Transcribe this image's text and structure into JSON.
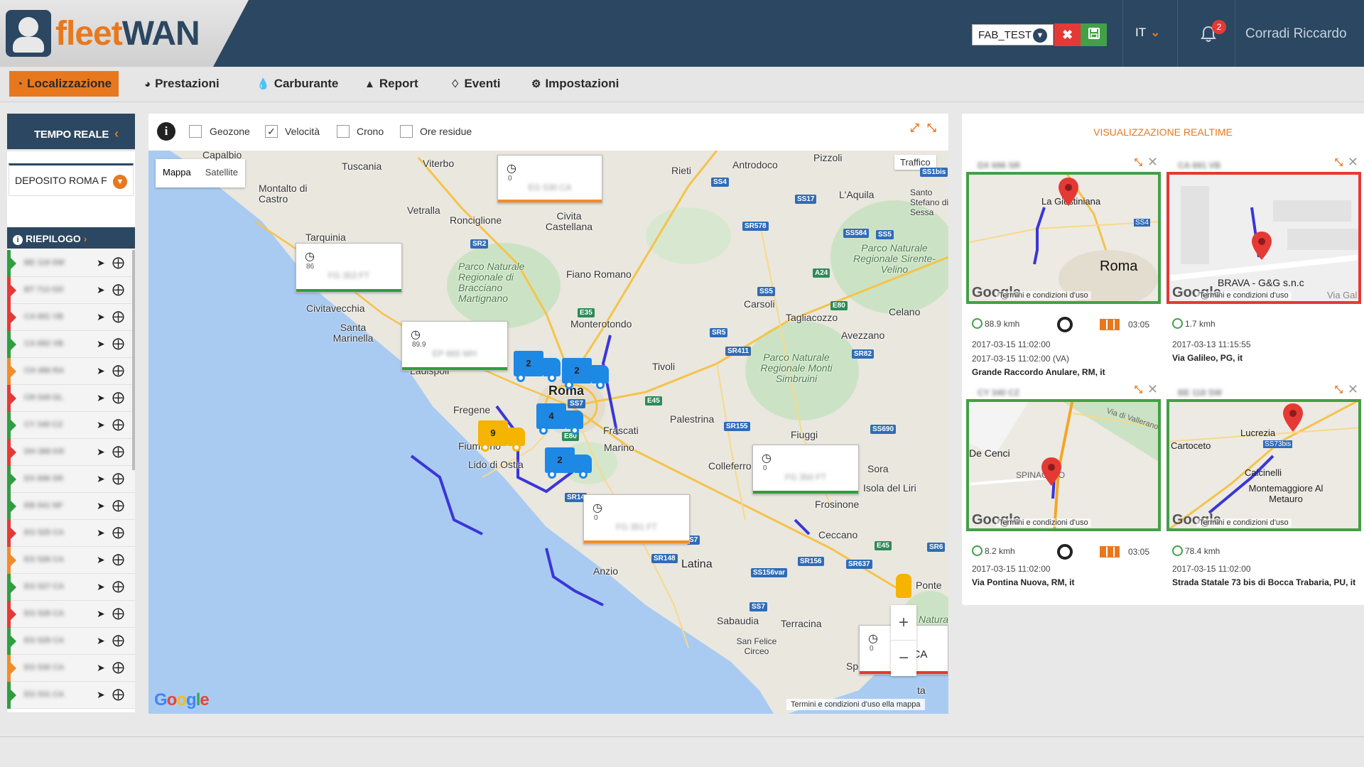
{
  "app": {
    "logo_part1": "fleet",
    "logo_part2": "WAN"
  },
  "header": {
    "profile_select": "FAB_TEST",
    "language": "IT",
    "notifications_count": "2",
    "user_name": "Corradi Riccardo"
  },
  "nav": {
    "items": [
      {
        "label": "Localizzazione",
        "icon": "dashboard-icon",
        "active": true
      },
      {
        "label": "Prestazioni",
        "icon": "pie-chart-icon"
      },
      {
        "label": "Carburante",
        "icon": "drop-icon"
      },
      {
        "label": "Report",
        "icon": "area-chart-icon"
      },
      {
        "label": "Eventi",
        "icon": "bell-icon"
      },
      {
        "label": "Impostazioni",
        "icon": "gear-icon"
      }
    ]
  },
  "left": {
    "mode_button": "TEMPO REALE",
    "depot_select": "DEPOSITO ROMA F",
    "summary_title": "RIEPILOGO",
    "vehicles": [
      {
        "plate": "BE 118 SW",
        "status_color": "#2e9e3f"
      },
      {
        "plate": "BT 713 GD",
        "status_color": "#e53935"
      },
      {
        "plate": "CA 691 VB",
        "status_color": "#e53935"
      },
      {
        "plate": "CA 692 VB",
        "status_color": "#2e9e3f"
      },
      {
        "plate": "CH 486 RA",
        "status_color": "#f28c28"
      },
      {
        "plate": "CR 549 DL",
        "status_color": "#e53935"
      },
      {
        "plate": "CY 340 CZ",
        "status_color": "#2e9e3f"
      },
      {
        "plate": "DH 388 KR",
        "status_color": "#e53935"
      },
      {
        "plate": "DX 696 SR",
        "status_color": "#2e9e3f"
      },
      {
        "plate": "EB 541 NF",
        "status_color": "#2e9e3f"
      },
      {
        "plate": "EG 525 CA",
        "status_color": "#e53935"
      },
      {
        "plate": "EG 526 CA",
        "status_color": "#f28c28"
      },
      {
        "plate": "EG 527 CA",
        "status_color": "#2e9e3f"
      },
      {
        "plate": "EG 528 CA",
        "status_color": "#e53935"
      },
      {
        "plate": "EG 529 CA",
        "status_color": "#2e9e3f"
      },
      {
        "plate": "EG 530 CA",
        "status_color": "#f28c28"
      },
      {
        "plate": "EG 531 CA",
        "status_color": "#2e9e3f"
      }
    ]
  },
  "map": {
    "filters": [
      {
        "label": "Geozone",
        "checked": false
      },
      {
        "label": "Velocità",
        "checked": true
      },
      {
        "label": "Crono",
        "checked": false
      },
      {
        "label": "Ore residue",
        "checked": false
      }
    ],
    "tab_map": "Mappa",
    "tab_satellite": "Satellite",
    "traffic_button": "Traffico",
    "terms": "Termini e condizioni d'uso",
    "terms_tail": "ella mappa",
    "google": "Google",
    "places": [
      "Capalbio",
      "Tuscania",
      "Viterbo",
      "Rieti",
      "Antrodoco",
      "Pizzoli",
      "L'Aquila",
      "Montalto di Castro",
      "Vetralla",
      "Ronciglione",
      "Civita Castellana",
      "Tarquinia",
      "Parco Naturale Regionale di Bracciano Martignano",
      "Fiano Romano",
      "Civitavecchia",
      "Santa Marinella",
      "Monterotondo",
      "Parco Naturale Regionale Sirente-Velino",
      "Carsoli",
      "Tagliacozzo",
      "Celano",
      "Avezzano",
      "Tivoli",
      "Roma",
      "Fregene",
      "Fiumicino",
      "Lido di Ostia",
      "Frascati",
      "Marino",
      "Palestrina",
      "Parco Naturale Regionale Monti Simbruini",
      "Fiuggi",
      "Colleferro",
      "Sora",
      "Isola del Liri",
      "Frosinone",
      "Ceccano",
      "Latina",
      "Anzio",
      "Sabaudia",
      "Terracina",
      "San Felice Circeo",
      "Ponte",
      "Ladispoli",
      "Santo Stefano di Sessa",
      "Natura",
      "Spe",
      "ta"
    ],
    "popups": [
      {
        "speed": "0",
        "plate": "EG 530 CA",
        "stripe": "#f28c28"
      },
      {
        "speed": "86",
        "plate": "FG 353 FT",
        "stripe": "#2e9e3f"
      },
      {
        "speed": "89.9",
        "plate": "EP 665 WH",
        "stripe": "#2e9e3f"
      },
      {
        "speed": "0",
        "plate": "FG 350 FT",
        "stripe": "#2e9e3f"
      },
      {
        "speed": "0",
        "plate": "FG 351 FT",
        "stripe": "#f28c28"
      },
      {
        "speed": "0",
        "plate": "8 CA",
        "stripe": "#e53935"
      }
    ],
    "clusters": [
      {
        "count": "2",
        "color": "#1e88e5"
      },
      {
        "count": "2",
        "color": "#1e88e5"
      },
      {
        "count": "4",
        "color": "#1e88e5"
      },
      {
        "count": "9",
        "color": "#f5b400"
      },
      {
        "count": "2",
        "color": "#1e88e5"
      }
    ],
    "roads": [
      "SS4",
      "SS17",
      "SR578",
      "SS584",
      "SS5",
      "A24",
      "SS1bis",
      "SR2",
      "E35",
      "SS5",
      "E80",
      "SR5",
      "SR411",
      "SR82",
      "E45",
      "SS7",
      "SR155",
      "SS690",
      "SR14",
      "SR148",
      "SS156var",
      "SR156",
      "SR637",
      "E45",
      "SR6",
      "SS7",
      "S4",
      "E80",
      "S7"
    ]
  },
  "right": {
    "title": "VISUALIZZAZIONE REALTIME",
    "cards": [
      {
        "plate": "DX 696 SR",
        "border": "#43a047",
        "speed": "88.9 kmh",
        "time": "03:05",
        "date1": "2017-03-15 11:02:00",
        "date2": "2017-03-15 11:02:00 (VA)",
        "address": "Grande Raccordo Anulare, RM, it",
        "map_labels": [
          "La Giustiniana",
          "Roma",
          "SS4"
        ]
      },
      {
        "plate": "CA 691 VB",
        "border": "#e53935",
        "speed": "1.7 kmh",
        "date1": "2017-03-13 11:15:55",
        "address": "Via Galileo, PG, it",
        "map_labels": [
          "BRAVA - G&G s.n.c",
          "Via Gal"
        ]
      },
      {
        "plate": "CY 340 CZ",
        "border": "#43a047",
        "speed": "8.2 kmh",
        "time": "03:05",
        "date1": "2017-03-15 11:02:00",
        "address": "Via Pontina Nuova, RM, it",
        "map_labels": [
          "De Cenci",
          "SPINACETO",
          "Via di Vallerano"
        ]
      },
      {
        "plate": "BE 118 SW",
        "border": "#43a047",
        "speed": "78.4 kmh",
        "date1": "2017-03-15 11:02:00",
        "address": "Strada Statale 73 bis di Bocca Trabaria, PU, it",
        "map_labels": [
          "Lucrezia",
          "Cartoceto",
          "Calcinelli",
          "Montemaggiore Al Metauro",
          "SS73bis"
        ]
      }
    ],
    "terms": "Termini e condizioni d'uso",
    "google": "Google"
  }
}
